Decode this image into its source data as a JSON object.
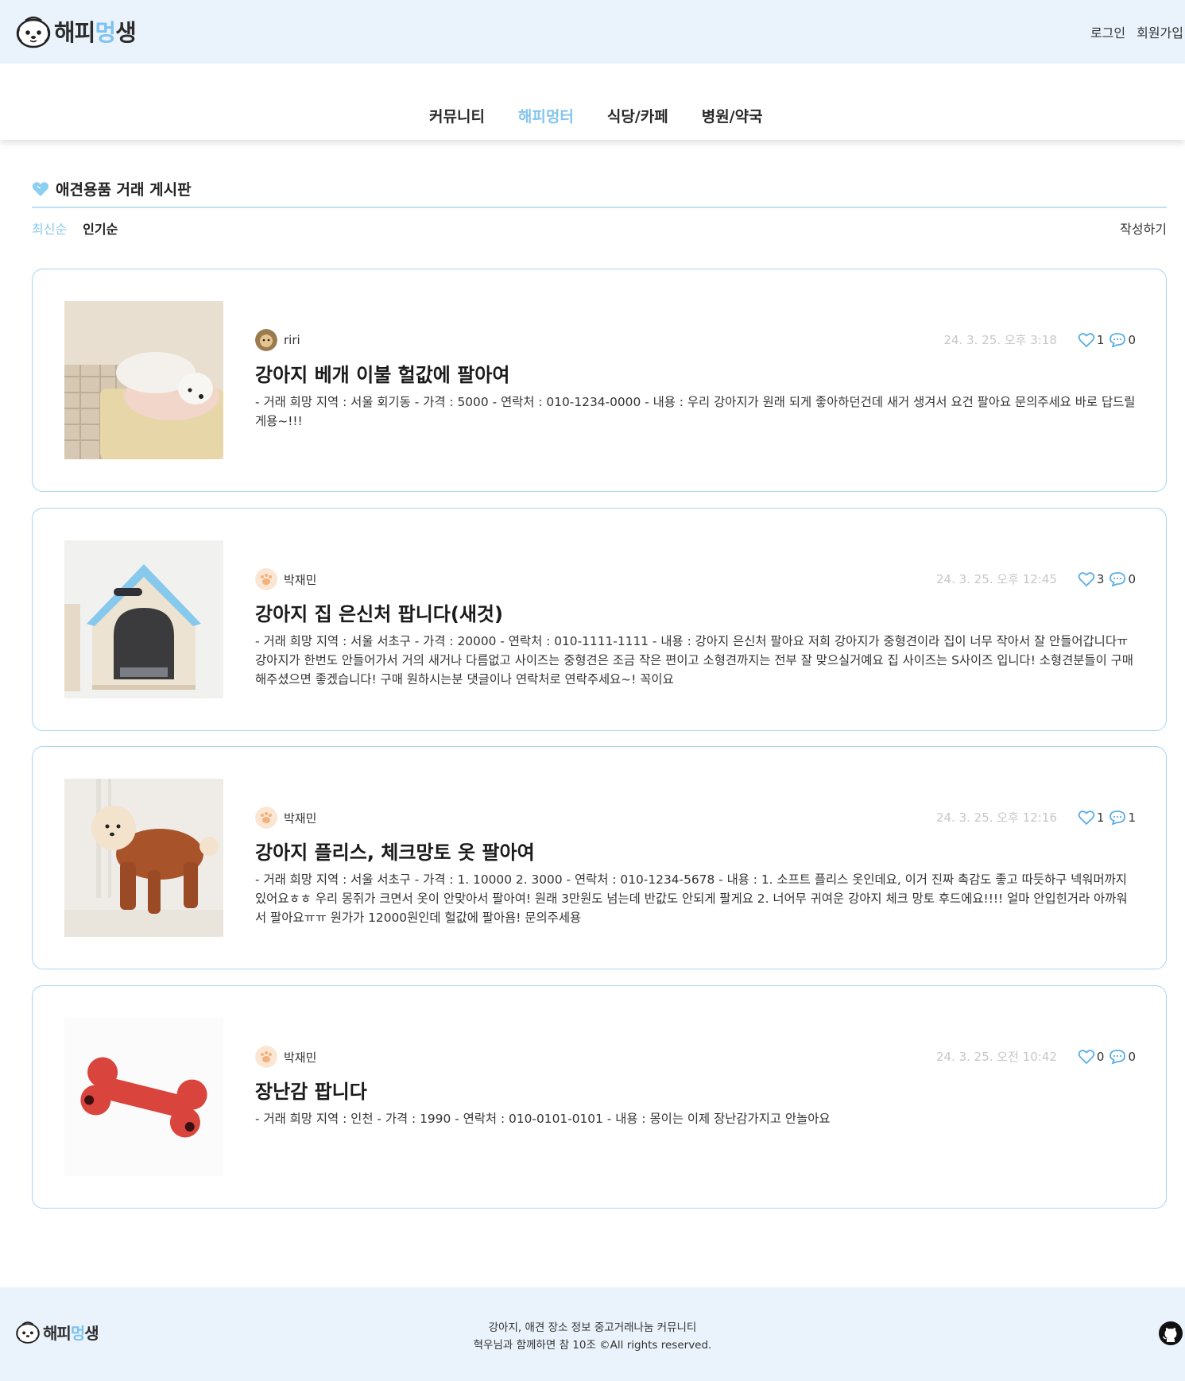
{
  "header": {
    "logo_prefix": "해피",
    "logo_mid": "멍",
    "logo_suffix": "생",
    "login": "로그인",
    "signup": "회원가입"
  },
  "nav": [
    "커뮤니티",
    "해피멍터",
    "식당/카페",
    "병원/약국"
  ],
  "board": {
    "title": "애견용품 거래 게시판",
    "sort_latest": "최신순",
    "sort_popular": "인기순",
    "write": "작성하기"
  },
  "posts": [
    {
      "author": "riri",
      "date": "24. 3. 25. 오후 3:18",
      "likes": "1",
      "comments": "0",
      "title": "강아지 베개 이불 헐값에 팔아여",
      "body": "- 거래 희망 지역 : 서울 회기동 - 가격 : 5000 - 연락처 : 010-1234-0000 - 내용 : 우리 강아지가 원래 되게 좋아하던건데 새거 생겨서 요건 팔아요 문의주세요 바로 답드릴게용~!!!"
    },
    {
      "author": "박재민",
      "date": "24. 3. 25. 오후 12:45",
      "likes": "3",
      "comments": "0",
      "title": "강아지 집 은신처 팝니다(새것)",
      "body": "- 거래 희망 지역 : 서울 서초구 - 가격 : 20000 - 연락처 : 010-1111-1111 - 내용 : 강아지 은신처 팔아요 저희 강아지가 중형견이라 집이 너무 작아서 잘 안들어갑니다ㅠ 강아지가 한번도 안들어가서 거의 새거나 다름없고 사이즈는 중형견은 조금 작은 편이고 소형견까지는 전부 잘 맞으실거예요 집 사이즈는 S사이즈 입니다! 소형견분들이 구매해주셨으면 좋겠습니다! 구매 원하시는분 댓글이나 연락처로 연락주세요~! 꼭이요"
    },
    {
      "author": "박재민",
      "date": "24. 3. 25. 오후 12:16",
      "likes": "1",
      "comments": "1",
      "title": "강아지 플리스, 체크망토 옷 팔아여",
      "body": "- 거래 희망 지역 : 서울 서초구 - 가격 : 1. 10000 2. 3000 - 연락처 : 010-1234-5678 - 내용 : 1. 소프트 플리스 옷인데요, 이거 진짜 촉감도 좋고 따듯하구 넥워머까지 있어요ㅎㅎ 우리 몽쥐가 크면서 옷이 안맞아서 팔아여! 원래 3만원도 넘는데 반값도 안되게 팔게요 2. 너어무 귀여운 강아지 체크 망토 후드에요!!!! 얼마 안입힌거라 아까워서 팔아요ㅠㅠ 원가가 12000원인데 헐값에 팔아욤! 문의주세용"
    },
    {
      "author": "박재민",
      "date": "24. 3. 25. 오전 10:42",
      "likes": "0",
      "comments": "0",
      "title": "장난감 팝니다",
      "body": "- 거래 희망 지역 : 인천 - 가격 : 1990 - 연락처 : 010-0101-0101 - 내용 : 몽이는 이제 장난감가지고 안놀아요"
    }
  ],
  "footer": {
    "line1": "강아지, 애견 장소 정보 중고거래나눔 커뮤니티",
    "line2": "혁우님과 함께하면 참 10조 ©All rights reserved."
  },
  "colors": {
    "accent": "#84c4ee",
    "header_bg": "#eaf3fc",
    "card_border": "#a9d5f2"
  }
}
